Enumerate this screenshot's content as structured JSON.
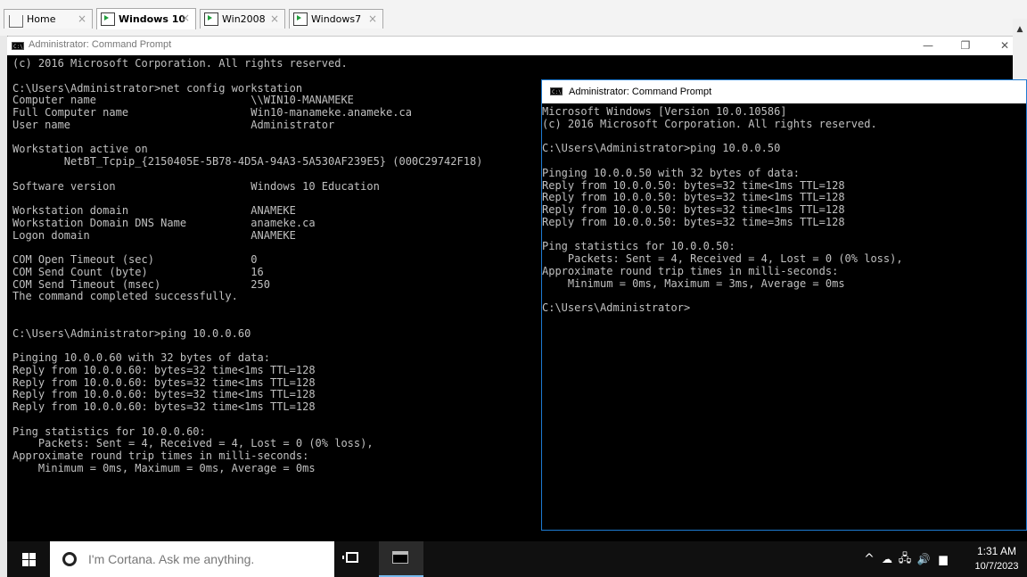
{
  "tabs": [
    {
      "label": "Home",
      "icon": "home-icon",
      "active": false
    },
    {
      "label": "Windows 10",
      "icon": "vm-icon",
      "active": true
    },
    {
      "label": "Win2008",
      "icon": "vm-icon",
      "active": false
    },
    {
      "label": "Windows7",
      "icon": "vm-icon",
      "active": false
    }
  ],
  "tab_close_glyph": "×",
  "main_window": {
    "title": "Administrator: Command Prompt",
    "icon_text": "C:\\",
    "minimize": "—",
    "maximize": "❐",
    "close": "✕",
    "console_text": "(c) 2016 Microsoft Corporation. All rights reserved.\n\nC:\\Users\\Administrator>net config workstation\nComputer name                        \\\\WIN10-MANAMEKE\nFull Computer name                   Win10-manameke.anameke.ca\nUser name                            Administrator\n\nWorkstation active on\n        NetBT_Tcpip_{2150405E-5B78-4D5A-94A3-5A530AF239E5} (000C29742F18)\n\nSoftware version                     Windows 10 Education\n\nWorkstation domain                   ANAMEKE\nWorkstation Domain DNS Name          anameke.ca\nLogon domain                         ANAMEKE\n\nCOM Open Timeout (sec)               0\nCOM Send Count (byte)                16\nCOM Send Timeout (msec)              250\nThe command completed successfully.\n\n\nC:\\Users\\Administrator>ping 10.0.0.60\n\nPinging 10.0.0.60 with 32 bytes of data:\nReply from 10.0.0.60: bytes=32 time<1ms TTL=128\nReply from 10.0.0.60: bytes=32 time<1ms TTL=128\nReply from 10.0.0.60: bytes=32 time<1ms TTL=128\nReply from 10.0.0.60: bytes=32 time<1ms TTL=128\n\nPing statistics for 10.0.0.60:\n    Packets: Sent = 4, Received = 4, Lost = 0 (0% loss),\nApproximate round trip times in milli-seconds:\n    Minimum = 0ms, Maximum = 0ms, Average = 0ms"
  },
  "scrollbar": {
    "up": "▲",
    "down": "▼"
  },
  "second_window": {
    "title": "Administrator: Command Prompt",
    "icon_text": "C:\\",
    "console_text": "Microsoft Windows [Version 10.0.10586]\n(c) 2016 Microsoft Corporation. All rights reserved.\n\nC:\\Users\\Administrator>ping 10.0.0.50\n\nPinging 10.0.0.50 with 32 bytes of data:\nReply from 10.0.0.50: bytes=32 time<1ms TTL=128\nReply from 10.0.0.50: bytes=32 time<1ms TTL=128\nReply from 10.0.0.50: bytes=32 time<1ms TTL=128\nReply from 10.0.0.50: bytes=32 time=3ms TTL=128\n\nPing statistics for 10.0.0.50:\n    Packets: Sent = 4, Received = 4, Lost = 0 (0% loss),\nApproximate round trip times in milli-seconds:\n    Minimum = 0ms, Maximum = 3ms, Average = 0ms\n\nC:\\Users\\Administrator>"
  },
  "taskbar": {
    "search_placeholder": "I'm Cortana. Ask me anything.",
    "tray": {
      "chevron": "^",
      "cloud": "☁",
      "network": "🖧",
      "volume": "🔊",
      "notifications": "▆"
    },
    "time": "1:31 AM",
    "date": "10/7/2023"
  },
  "colors": {
    "console_bg": "#000000",
    "console_fg": "#c0c0c0",
    "taskbar_bg": "#101010",
    "active_border": "#1e7bd2"
  }
}
